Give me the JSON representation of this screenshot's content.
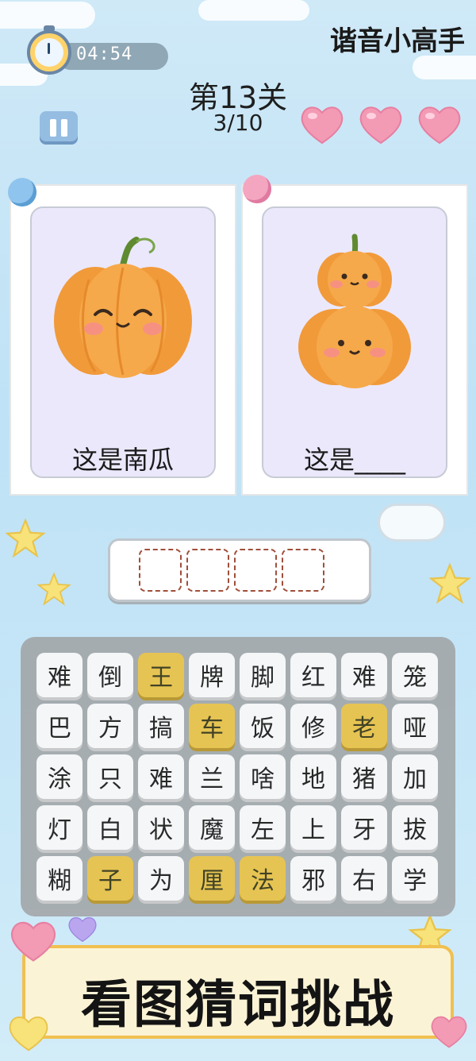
{
  "header": {
    "app_title": "谐音小高手",
    "timer": "04:54",
    "level": "第13关",
    "progress": "3/10",
    "lives": 3
  },
  "icons": {
    "timer": "stopwatch-icon",
    "pause": "pause-icon",
    "life": "heart-icon",
    "pin": "pushpin-icon",
    "decor": "star-icon"
  },
  "cards": [
    {
      "caption": "这是南瓜",
      "art": "single-pumpkin"
    },
    {
      "caption": "这是____",
      "art": "stacked-pumpkins"
    }
  ],
  "answer": {
    "slots": 4
  },
  "letter_grid": {
    "rows": [
      [
        "难",
        "倒",
        "王",
        "牌",
        "脚",
        "红",
        "难",
        "笼"
      ],
      [
        "巴",
        "方",
        "搞",
        "车",
        "饭",
        "修",
        "老",
        "哑"
      ],
      [
        "涂",
        "只",
        "难",
        "兰",
        "啥",
        "地",
        "猪",
        "加"
      ],
      [
        "灯",
        "白",
        "状",
        "魔",
        "左",
        "上",
        "牙",
        "拔"
      ],
      [
        "糊",
        "子",
        "为",
        "厘",
        "法",
        "邪",
        "右",
        "学"
      ]
    ]
  },
  "banner": {
    "text": "看图猜词挑战"
  },
  "colors": {
    "background": "#c6e6f7",
    "tile": "#f7f7f7",
    "tile_used": "#e8c34b",
    "heart": "#f39ab5",
    "banner_border": "#f0c050"
  }
}
